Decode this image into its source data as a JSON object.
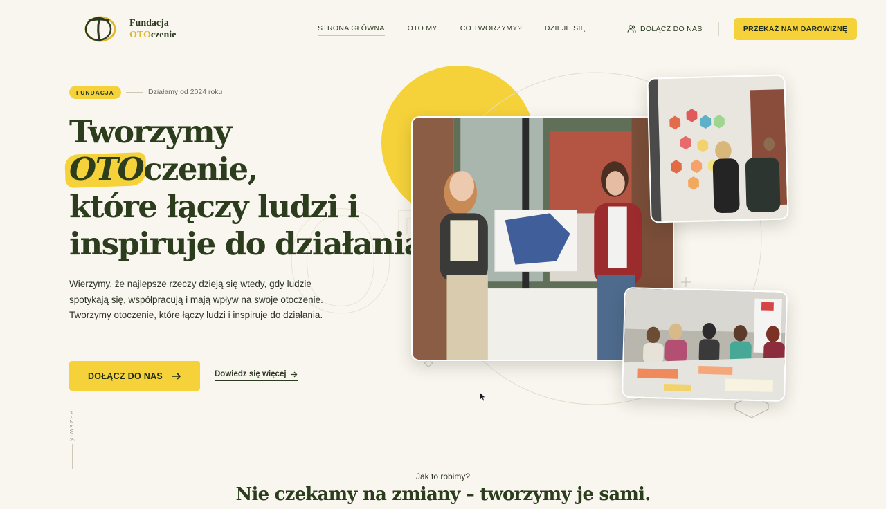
{
  "header": {
    "logo": {
      "line1": "Fundacja",
      "line2_accent": "OTO",
      "line2_rest": "czenie",
      "icon": "logo-mark-icon"
    },
    "nav": [
      {
        "label": "STRONA GŁÓWNA",
        "active": true
      },
      {
        "label": "OTO MY",
        "active": false
      },
      {
        "label": "CO TWORZYMY?",
        "active": false
      },
      {
        "label": "DZIEJE SIĘ",
        "active": false
      }
    ],
    "join_label": "DOŁĄCZ DO NAS",
    "join_icon": "users-icon",
    "donate_label": "PRZEKAŻ NAM DAROWIZNĘ"
  },
  "hero": {
    "badge": "FUNDACJA",
    "since": "Działamy od 2024 roku",
    "headline": {
      "line1": "Tworzymy",
      "highlight": "OTO",
      "line2_rest": "czenie,",
      "line3": "które łączy ludzi i",
      "line4": "inspiruje do działania"
    },
    "lead": "Wierzymy, że najlepsze rzeczy dzieją się wtedy, gdy ludzie spotykają się, współpracują i mają wpływ na swoje otoczenie. Tworzymy otoczenie, które łączy ludzi i inspiruje do działania.",
    "cta_label": "DOŁĄCZ DO NAS",
    "cta_icon": "arrow-right-icon",
    "more_label": "Dowiedz się więcej",
    "more_icon": "arrow-right-icon",
    "scroll_label": "PRZEWIŃ"
  },
  "photos": {
    "main": "two-women-presenting-map-photo",
    "top": "workshop-hexagon-wall-photo",
    "bottom": "meeting-table-photo"
  },
  "colors": {
    "accent": "#f5d23a",
    "text": "#2c3d1e",
    "background": "#f8f6ee"
  },
  "section": {
    "eyebrow": "Jak to robimy?",
    "title": "Nie czekamy na zmiany – tworzymy je sami."
  }
}
